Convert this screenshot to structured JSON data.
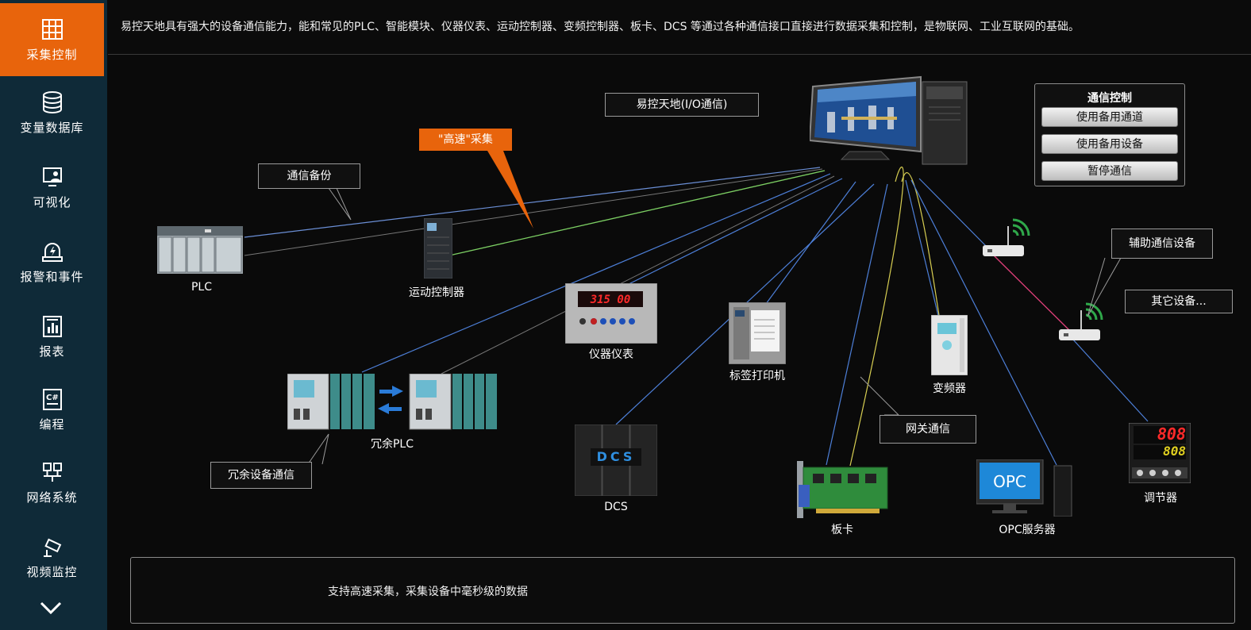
{
  "sidebar": {
    "items": [
      {
        "label": "采集控制",
        "icon": "table-grid-icon",
        "active": true
      },
      {
        "label": "变量数据库",
        "icon": "database-icon",
        "active": false
      },
      {
        "label": "可视化",
        "icon": "monitor-user-icon",
        "active": false
      },
      {
        "label": "报警和事件",
        "icon": "alarm-bolt-icon",
        "active": false
      },
      {
        "label": "报表",
        "icon": "report-chart-icon",
        "active": false
      },
      {
        "label": "编程",
        "icon": "csharp-code-icon",
        "active": false
      },
      {
        "label": "网络系统",
        "icon": "network-icon",
        "active": false
      },
      {
        "label": "视频监控",
        "icon": "camera-icon",
        "active": false
      }
    ],
    "more_icon": "chevron-down-icon",
    "accent_color": "#e8640c",
    "background_color": "#0f2a38"
  },
  "header": {
    "description": "易控天地具有强大的设备通信能力，能和常见的PLC、智能模块、仪器仪表、运动控制器、变频控制器、板卡、DCS 等通过各种通信接口直接进行数据采集和控制，是物联网、工业互联网的基础。"
  },
  "diagram": {
    "hub_label": "易控天地(I/O通信)",
    "callouts": {
      "backup": "通信备份",
      "high_speed": "\"高速\"采集",
      "redundant": "冗余设备通信",
      "gateway": "网关通信",
      "aux": "辅助通信设备",
      "other": "其它设备..."
    },
    "devices": {
      "plc": "PLC",
      "motion": "运动控制器",
      "instrument": "仪器仪表",
      "instrument_display": "315 00",
      "redundant_plc": "冗余PLC",
      "printer": "标签打印机",
      "dcs": "DCS",
      "dcs_display": "DCS",
      "vfd": "变频器",
      "card": "板卡",
      "opc": "OPC服务器",
      "opc_logo": "OPC",
      "regulator": "调节器",
      "regulator_display_top": "808",
      "regulator_display_bottom": "808"
    }
  },
  "comm_panel": {
    "title": "通信控制",
    "buttons": [
      "使用备用通道",
      "使用备用设备",
      "暂停通信"
    ]
  },
  "footer": {
    "text": "支持高速采集，采集设备中毫秒级的数据"
  }
}
